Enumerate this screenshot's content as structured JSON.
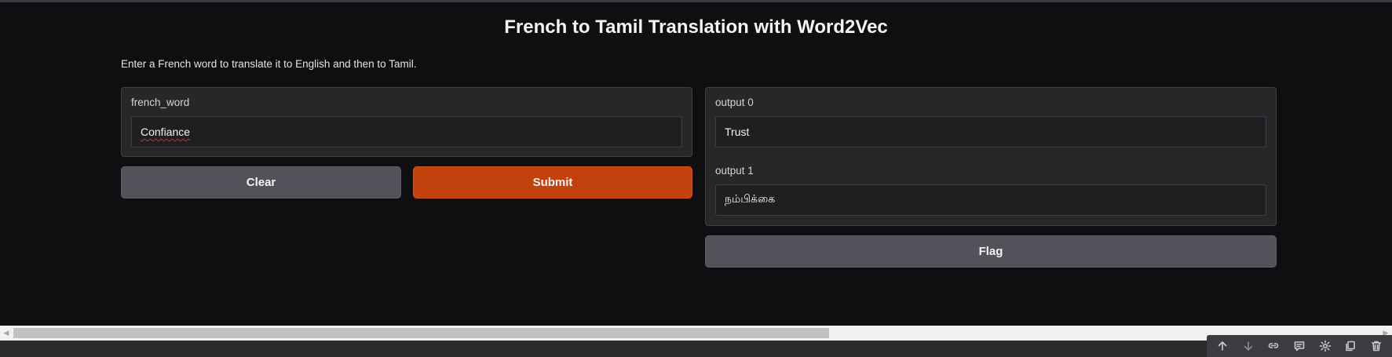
{
  "app": {
    "title": "French to Tamil Translation with Word2Vec",
    "description": "Enter a French word to translate it to English and then to Tamil."
  },
  "input_panel": {
    "label": "french_word",
    "value": "Confiance"
  },
  "buttons": {
    "clear_label": "Clear",
    "submit_label": "Submit",
    "flag_label": "Flag"
  },
  "output_panel": {
    "outputs": [
      {
        "label": "output 0",
        "value": "Trust"
      },
      {
        "label": "output 1",
        "value": "நம்பிக்கை"
      }
    ]
  },
  "toolbar": {
    "icons": [
      "arrow-up-icon",
      "arrow-down-icon",
      "link-icon",
      "comment-icon",
      "gear-icon",
      "copy-icon",
      "trash-icon"
    ]
  },
  "colors": {
    "background": "#0f0f11",
    "panel": "#27272a",
    "primary_button": "#c2410c",
    "secondary_button": "#52525b"
  }
}
